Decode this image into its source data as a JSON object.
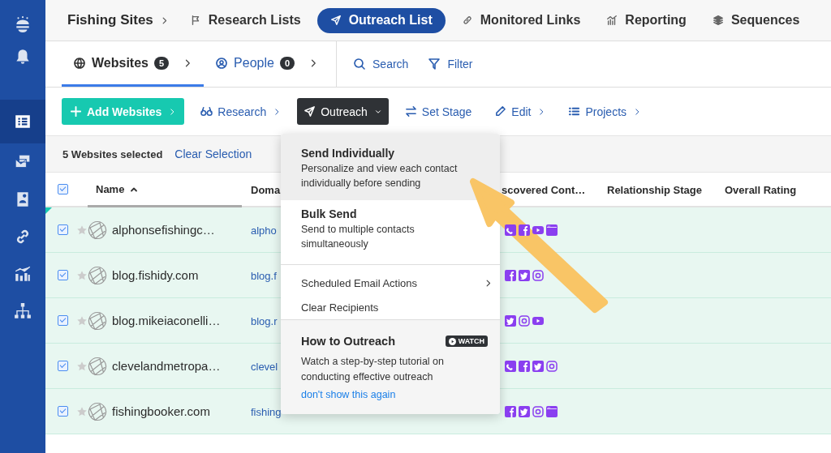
{
  "sidebar": {
    "items": [
      {
        "kind": "logo",
        "selected": false
      },
      {
        "kind": "bell",
        "selected": false
      },
      {
        "kind": "list",
        "selected": true
      },
      {
        "kind": "mail",
        "selected": false
      },
      {
        "kind": "contact",
        "selected": false
      },
      {
        "kind": "link",
        "selected": false
      },
      {
        "kind": "chart",
        "selected": false
      },
      {
        "kind": "sitemap",
        "selected": false
      }
    ]
  },
  "breadcrumb": "Fishing Sites",
  "nav": [
    {
      "label": "Research Lists",
      "selected": false
    },
    {
      "label": "Outreach List",
      "selected": true
    },
    {
      "label": "Monitored Links",
      "selected": false
    },
    {
      "label": "Reporting",
      "selected": false
    },
    {
      "label": "Sequences",
      "selected": false
    }
  ],
  "tabs": [
    {
      "label": "Websites",
      "count": "5",
      "selected": true
    },
    {
      "label": "People",
      "count": "0",
      "selected": false
    }
  ],
  "tab_actions": [
    {
      "label": "Search"
    },
    {
      "label": "Filter"
    }
  ],
  "toolbar": [
    {
      "label": "Add Websites",
      "kind": "primary",
      "submenu": true
    },
    {
      "label": "Research",
      "kind": "link",
      "submenu": true
    },
    {
      "label": "Outreach",
      "kind": "dropdown",
      "submenu": false
    },
    {
      "label": "Set Stage",
      "kind": "link",
      "submenu": false
    },
    {
      "label": "Edit",
      "kind": "link",
      "submenu": true
    },
    {
      "label": "Projects",
      "kind": "link",
      "submenu": true
    }
  ],
  "selection": {
    "text": "5 Websites selected",
    "action": "Clear Selection"
  },
  "table": {
    "all_checked": true,
    "columns": [
      "Name",
      "Doma",
      "scovered Cont…",
      "Relationship Stage",
      "Overall Rating"
    ],
    "rows": [
      {
        "checked": true,
        "starred": false,
        "name": "alphonsefishingc…",
        "domain": "alpho",
        "contacts": [
          {
            "kind": "phone"
          },
          {
            "kind": "facebook"
          },
          {
            "kind": "youtube"
          },
          {
            "kind": "web"
          }
        ]
      },
      {
        "checked": true,
        "starred": false,
        "name": "blog.fishidy.com",
        "domain": "blog.f",
        "contacts": [
          {
            "kind": "facebook"
          },
          {
            "kind": "twitter"
          },
          {
            "kind": "instagram"
          }
        ]
      },
      {
        "checked": true,
        "starred": false,
        "name": "blog.mikeiaconelli…",
        "domain": "blog.r",
        "contacts": [
          {
            "kind": "twitter"
          },
          {
            "kind": "instagram"
          },
          {
            "kind": "youtube"
          }
        ]
      },
      {
        "checked": true,
        "starred": false,
        "name": "clevelandmetropa…",
        "domain": "clevel",
        "contacts": [
          {
            "kind": "phone"
          },
          {
            "kind": "facebook"
          },
          {
            "kind": "twitter"
          },
          {
            "kind": "instagram"
          }
        ]
      },
      {
        "checked": true,
        "starred": false,
        "name": "fishingbooker.com",
        "domain": "fishing",
        "contacts": [
          {
            "kind": "facebook"
          },
          {
            "kind": "twitter"
          },
          {
            "kind": "instagram"
          },
          {
            "kind": "web"
          }
        ]
      }
    ]
  },
  "menu": {
    "items": [
      {
        "kind": "described",
        "title": "Send Individually",
        "description": "Personalize and view each contact individually before sending",
        "selected": true
      },
      {
        "kind": "described",
        "title": "Bulk Send",
        "description": "Send to multiple contacts simultaneously",
        "selected": false
      },
      {
        "kind": "divider"
      },
      {
        "kind": "plain",
        "title": "Scheduled Email Actions",
        "submenu": true,
        "selected": false
      },
      {
        "kind": "plain",
        "title": "Clear Recipients",
        "submenu": false,
        "selected": false
      }
    ],
    "tip": {
      "title": "How to Outreach",
      "badge": "WATCH",
      "text": "Watch a step-by-step tutorial on conducting effective outreach",
      "link": "don't show this again"
    }
  }
}
